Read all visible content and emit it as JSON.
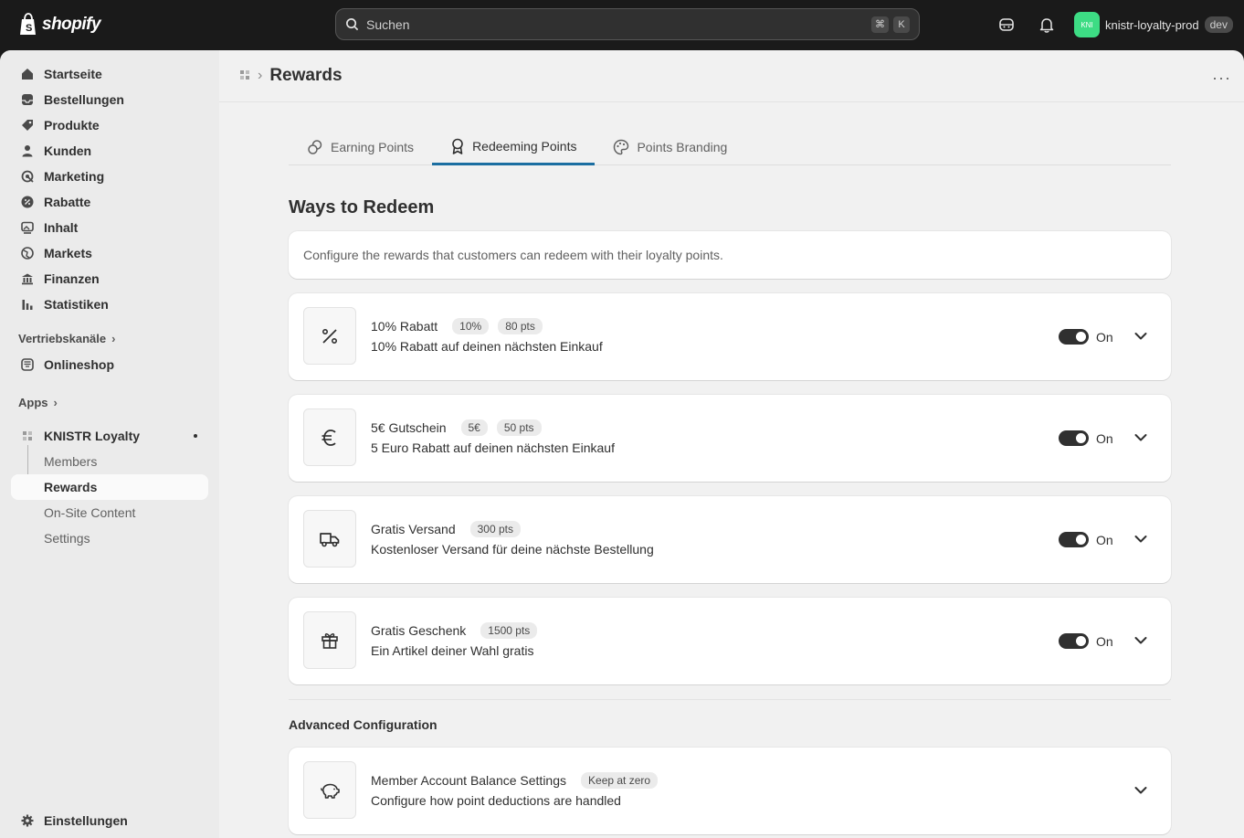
{
  "topbar": {
    "logo_text": "shopify",
    "search_placeholder": "Suchen",
    "shortcut_cmd": "⌘",
    "shortcut_key": "K",
    "store_avatar": "KNI",
    "store_name": "knistr-loyalty-prod",
    "store_env": "dev"
  },
  "sidebar": {
    "items": [
      {
        "label": "Startseite",
        "icon": "home-icon"
      },
      {
        "label": "Bestellungen",
        "icon": "inbox-icon"
      },
      {
        "label": "Produkte",
        "icon": "tag-icon"
      },
      {
        "label": "Kunden",
        "icon": "person-icon"
      },
      {
        "label": "Marketing",
        "icon": "target-icon"
      },
      {
        "label": "Rabatte",
        "icon": "discount-icon"
      },
      {
        "label": "Inhalt",
        "icon": "image-icon"
      },
      {
        "label": "Markets",
        "icon": "globe-icon"
      },
      {
        "label": "Finanzen",
        "icon": "bank-icon"
      },
      {
        "label": "Statistiken",
        "icon": "chart-icon"
      }
    ],
    "sales_channels_label": "Vertriebskanäle",
    "online_store_label": "Onlineshop",
    "apps_label": "Apps",
    "app_name": "KNISTR Loyalty",
    "app_subitems": [
      "Members",
      "Rewards",
      "On-Site Content",
      "Settings"
    ],
    "settings_label": "Einstellungen"
  },
  "header": {
    "title": "Rewards",
    "separator": "›"
  },
  "tabs": [
    {
      "label": "Earning Points",
      "icon": "coins-icon"
    },
    {
      "label": "Redeeming Points",
      "icon": "ribbon-icon"
    },
    {
      "label": "Points Branding",
      "icon": "palette-icon"
    }
  ],
  "ways_to_redeem": {
    "heading": "Ways to Redeem",
    "description": "Configure the rewards that customers can redeem with their loyalty points."
  },
  "rewards": [
    {
      "title": "10% Rabatt",
      "badges": [
        "10%",
        "80 pts"
      ],
      "desc": "10% Rabatt auf deinen nächsten Einkauf",
      "icon": "percent-icon",
      "status": "On"
    },
    {
      "title": "5€ Gutschein",
      "badges": [
        "5€",
        "50 pts"
      ],
      "desc": "5 Euro Rabatt auf deinen nächsten Einkauf",
      "icon": "euro-icon",
      "status": "On"
    },
    {
      "title": "Gratis Versand",
      "badges": [
        "300 pts"
      ],
      "desc": "Kostenloser Versand für deine nächste Bestellung",
      "icon": "truck-icon",
      "status": "On"
    },
    {
      "title": "Gratis Geschenk",
      "badges": [
        "1500 pts"
      ],
      "desc": "Ein Artikel deiner Wahl gratis",
      "icon": "gift-icon",
      "status": "On"
    }
  ],
  "advanced": {
    "heading": "Advanced Configuration",
    "title": "Member Account Balance Settings",
    "badge": "Keep at zero",
    "desc": "Configure how point deductions are handled",
    "icon": "piggy-bank-icon"
  },
  "colors": {
    "accent": "#1b6ea1",
    "topbar_bg": "#1a1a1a",
    "page_bg": "#f1f1f1",
    "store_avatar": "#3ddc84"
  }
}
